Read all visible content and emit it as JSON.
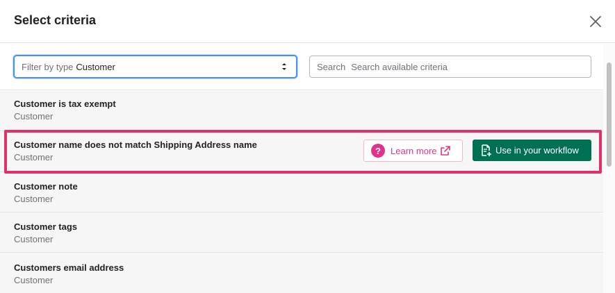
{
  "modal": {
    "title": "Select criteria"
  },
  "filter": {
    "prefix": "Filter by type",
    "value": "Customer"
  },
  "search": {
    "prefix": "Search",
    "placeholder": "Search available criteria"
  },
  "criteria": [
    {
      "name": "Customer is tax exempt",
      "type": "Customer"
    },
    {
      "name": "Customer name does not match Shipping Address name",
      "type": "Customer"
    },
    {
      "name": "Customer note",
      "type": "Customer"
    },
    {
      "name": "Customer tags",
      "type": "Customer"
    },
    {
      "name": "Customers email address",
      "type": "Customer"
    }
  ],
  "actions": {
    "learn_more_label": "Learn more",
    "use_label": "Use in your workflow"
  },
  "colors": {
    "accent_pink": "#e0348a",
    "highlight_border": "#e0306d",
    "primary_green": "#007053",
    "focus_blue": "#458fff"
  },
  "icons": {
    "close": "close-icon",
    "select_caret": "select-caret-icon",
    "help": "question-circle-icon",
    "external": "external-link-icon",
    "workflow": "document-add-icon"
  }
}
